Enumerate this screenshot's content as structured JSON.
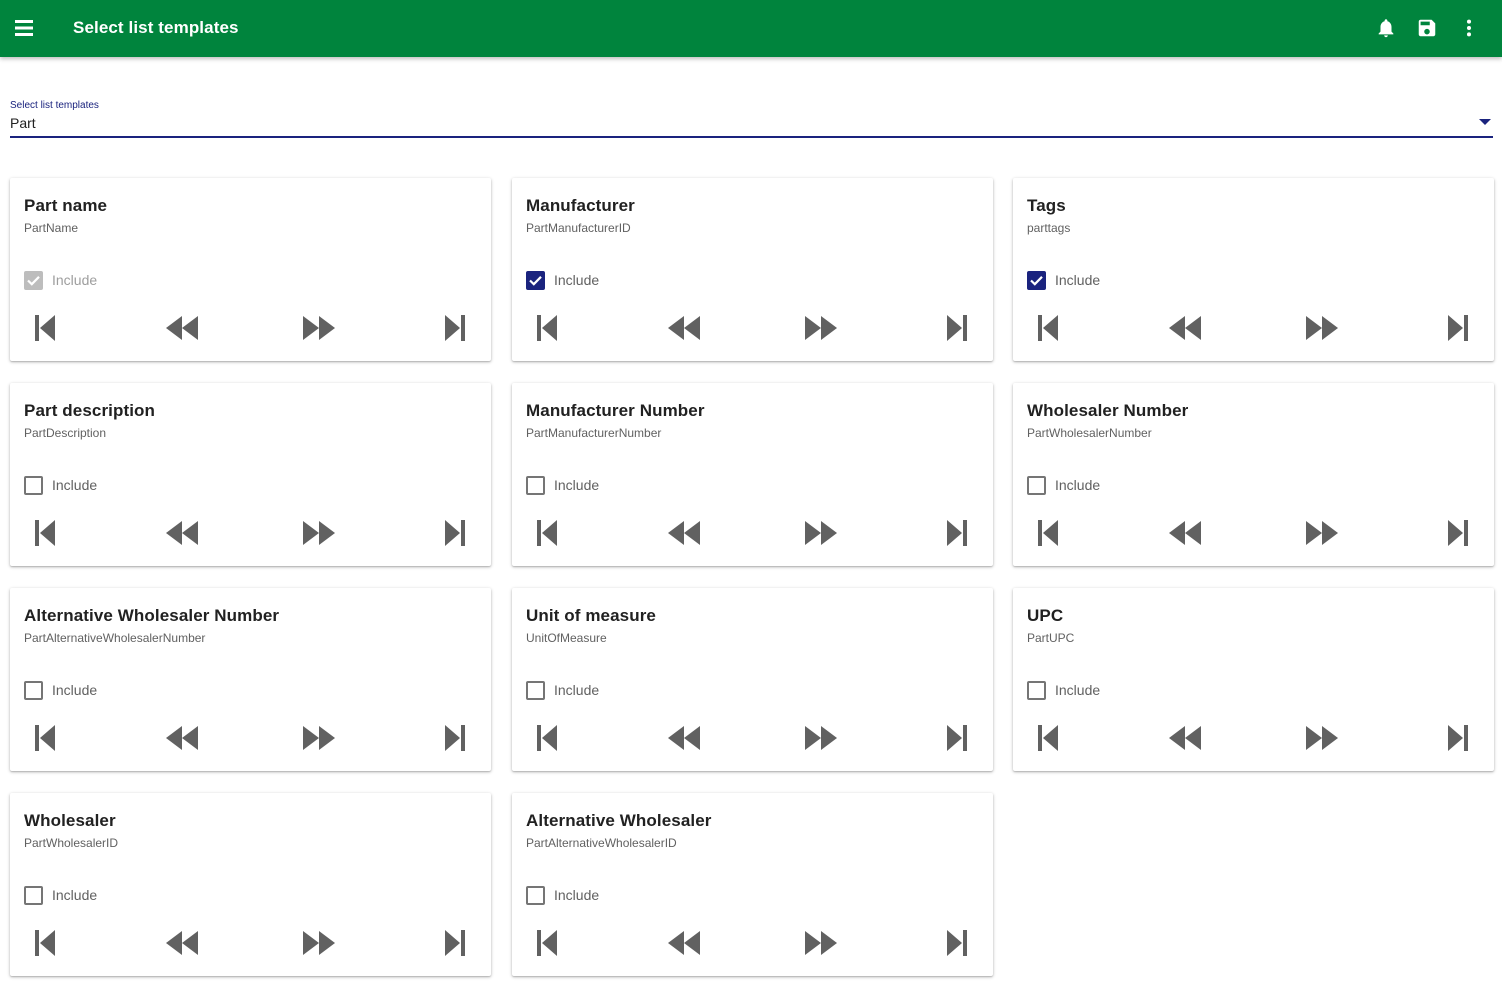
{
  "appbar": {
    "title": "Select list templates",
    "background": "#00843d",
    "icons": [
      "menu-icon",
      "bell-icon",
      "save-icon",
      "more-vert-icon"
    ]
  },
  "select": {
    "label": "Select list templates",
    "value": "Part",
    "accent": "#1a237e"
  },
  "include_label": "Include",
  "cards": [
    {
      "title": "Part name",
      "field": "PartName",
      "include": "disabled-checked"
    },
    {
      "title": "Manufacturer",
      "field": "PartManufacturerID",
      "include": "checked"
    },
    {
      "title": "Tags",
      "field": "parttags",
      "include": "checked"
    },
    {
      "title": "Part description",
      "field": "PartDescription",
      "include": "unchecked"
    },
    {
      "title": "Manufacturer Number",
      "field": "PartManufacturerNumber",
      "include": "unchecked"
    },
    {
      "title": "Wholesaler Number",
      "field": "PartWholesalerNumber",
      "include": "unchecked"
    },
    {
      "title": "Alternative Wholesaler Number",
      "field": "PartAlternativeWholesalerNumber",
      "include": "unchecked"
    },
    {
      "title": "Unit of measure",
      "field": "UnitOfMeasure",
      "include": "unchecked"
    },
    {
      "title": "UPC",
      "field": "PartUPC",
      "include": "unchecked"
    },
    {
      "title": "Wholesaler",
      "field": "PartWholesalerID",
      "include": "unchecked"
    },
    {
      "title": "Alternative Wholesaler",
      "field": "PartAlternativeWholesalerID",
      "include": "unchecked"
    }
  ],
  "card_nav_icons": [
    "skip-first-icon",
    "rewind-icon",
    "fast-forward-icon",
    "skip-last-icon"
  ]
}
